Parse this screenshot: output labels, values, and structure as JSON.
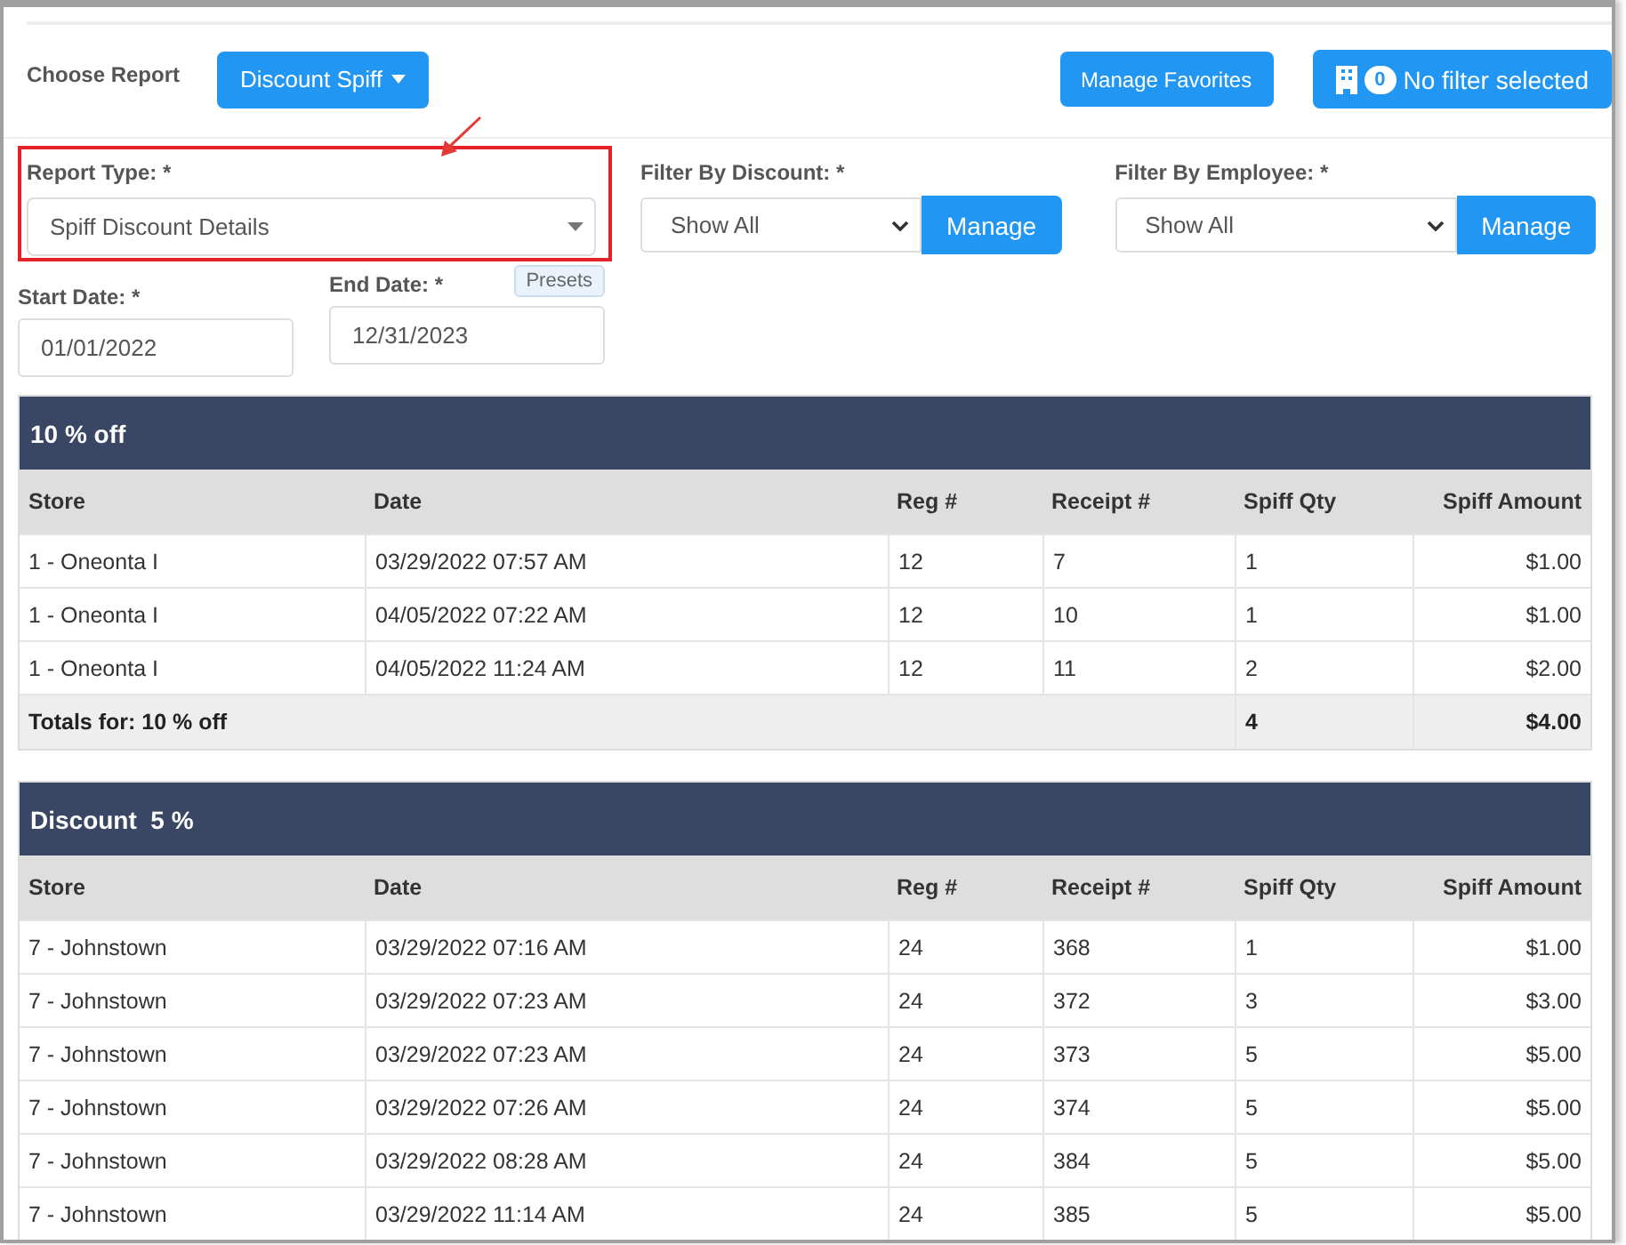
{
  "header": {
    "choose_report_label": "Choose Report",
    "report_button": "Discount Spiff",
    "favorites_button": "Manage Favorites",
    "filter_button": {
      "count": "0",
      "label": "No filter selected"
    }
  },
  "filters": {
    "report_type": {
      "label": "Report Type: *",
      "value": "Spiff Discount Details",
      "highlighted": true
    },
    "discount": {
      "label": "Filter By Discount: *",
      "value": "Show All",
      "button": "Manage"
    },
    "employee": {
      "label": "Filter By Employee: *",
      "value": "Show All",
      "button": "Manage"
    }
  },
  "dates": {
    "start": {
      "label": "Start Date: *",
      "value": "01/01/2022"
    },
    "end": {
      "label": "End Date: *",
      "value": "12/31/2023",
      "presets": "Presets"
    }
  },
  "groups": [
    {
      "title": "10 % off",
      "columns": [
        "Store",
        "Date",
        "Reg #",
        "Receipt #",
        "Spiff Qty",
        "Spiff Amount"
      ],
      "rows": [
        [
          "1 - Oneonta I",
          "03/29/2022 07:57 AM",
          "12",
          "7",
          "1",
          "$1.00"
        ],
        [
          "1 - Oneonta I",
          "04/05/2022 07:22 AM",
          "12",
          "10",
          "1",
          "$1.00"
        ],
        [
          "1 - Oneonta I",
          "04/05/2022 11:24 AM",
          "12",
          "11",
          "2",
          "$2.00"
        ]
      ],
      "totals": {
        "label": "Totals for: 10 % off",
        "qty": "4",
        "amount": "$4.00"
      }
    },
    {
      "title": "Discount  5 %",
      "columns": [
        "Store",
        "Date",
        "Reg #",
        "Receipt #",
        "Spiff Qty",
        "Spiff Amount"
      ],
      "rows": [
        [
          "7 - Johnstown",
          "03/29/2022 07:16 AM",
          "24",
          "368",
          "1",
          "$1.00"
        ],
        [
          "7 - Johnstown",
          "03/29/2022 07:23 AM",
          "24",
          "372",
          "3",
          "$3.00"
        ],
        [
          "7 - Johnstown",
          "03/29/2022 07:23 AM",
          "24",
          "373",
          "5",
          "$5.00"
        ],
        [
          "7 - Johnstown",
          "03/29/2022 07:26 AM",
          "24",
          "374",
          "5",
          "$5.00"
        ],
        [
          "7 - Johnstown",
          "03/29/2022 08:28 AM",
          "24",
          "384",
          "5",
          "$5.00"
        ],
        [
          "7 - Johnstown",
          "03/29/2022 11:14 AM",
          "24",
          "385",
          "5",
          "$5.00"
        ]
      ]
    }
  ]
}
